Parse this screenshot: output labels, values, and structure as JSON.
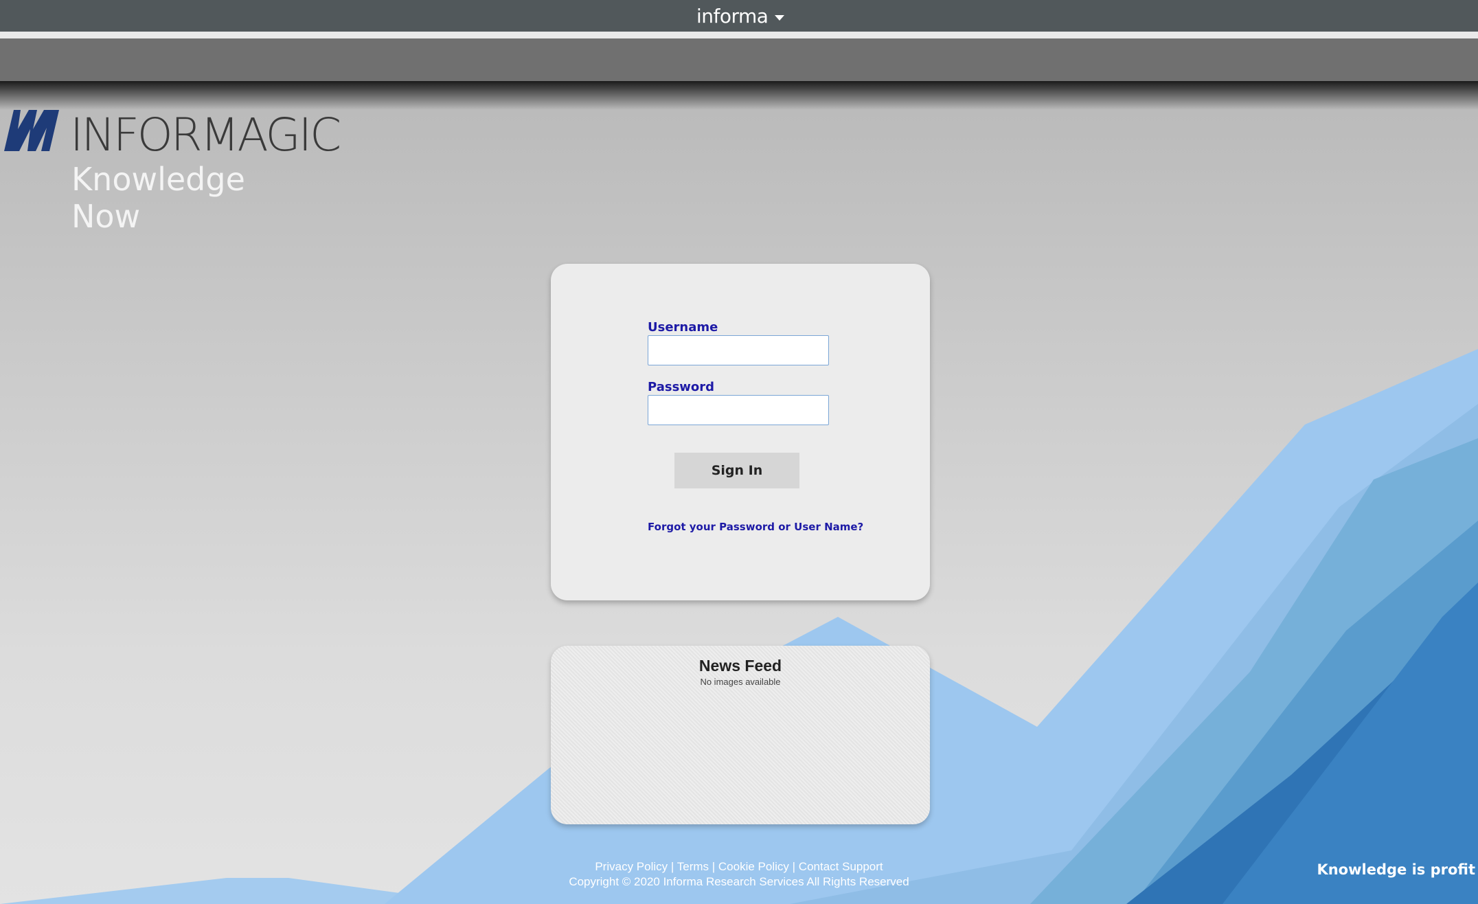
{
  "topbar": {
    "brand": "informa",
    "menu_icon": "chevron-down-icon"
  },
  "logo": {
    "wordmark": "INFORMAGIC",
    "tagline": "Knowledge Now",
    "icon": "informagic-logo-icon"
  },
  "login": {
    "username_label": "Username",
    "username_value": "",
    "password_label": "Password",
    "password_value": "",
    "signin_label": "Sign In",
    "forgot_label": "Forgot your Password or User Name?"
  },
  "news": {
    "title": "News Feed",
    "subtitle": "No images available"
  },
  "footer": {
    "links": [
      "Privacy Policy",
      "Terms",
      "Cookie Policy",
      "Contact Support"
    ],
    "separator": "|",
    "copyright": "Copyright © 2020 Informa Research Services All Rights Reserved"
  },
  "background": {
    "slogan": "Knowledge is profit"
  },
  "colors": {
    "topbar": "#51585b",
    "label_blue": "#1d1aa6",
    "graph_blue_light": "#9cc6ee",
    "graph_blue_dark": "#2f74b5"
  }
}
